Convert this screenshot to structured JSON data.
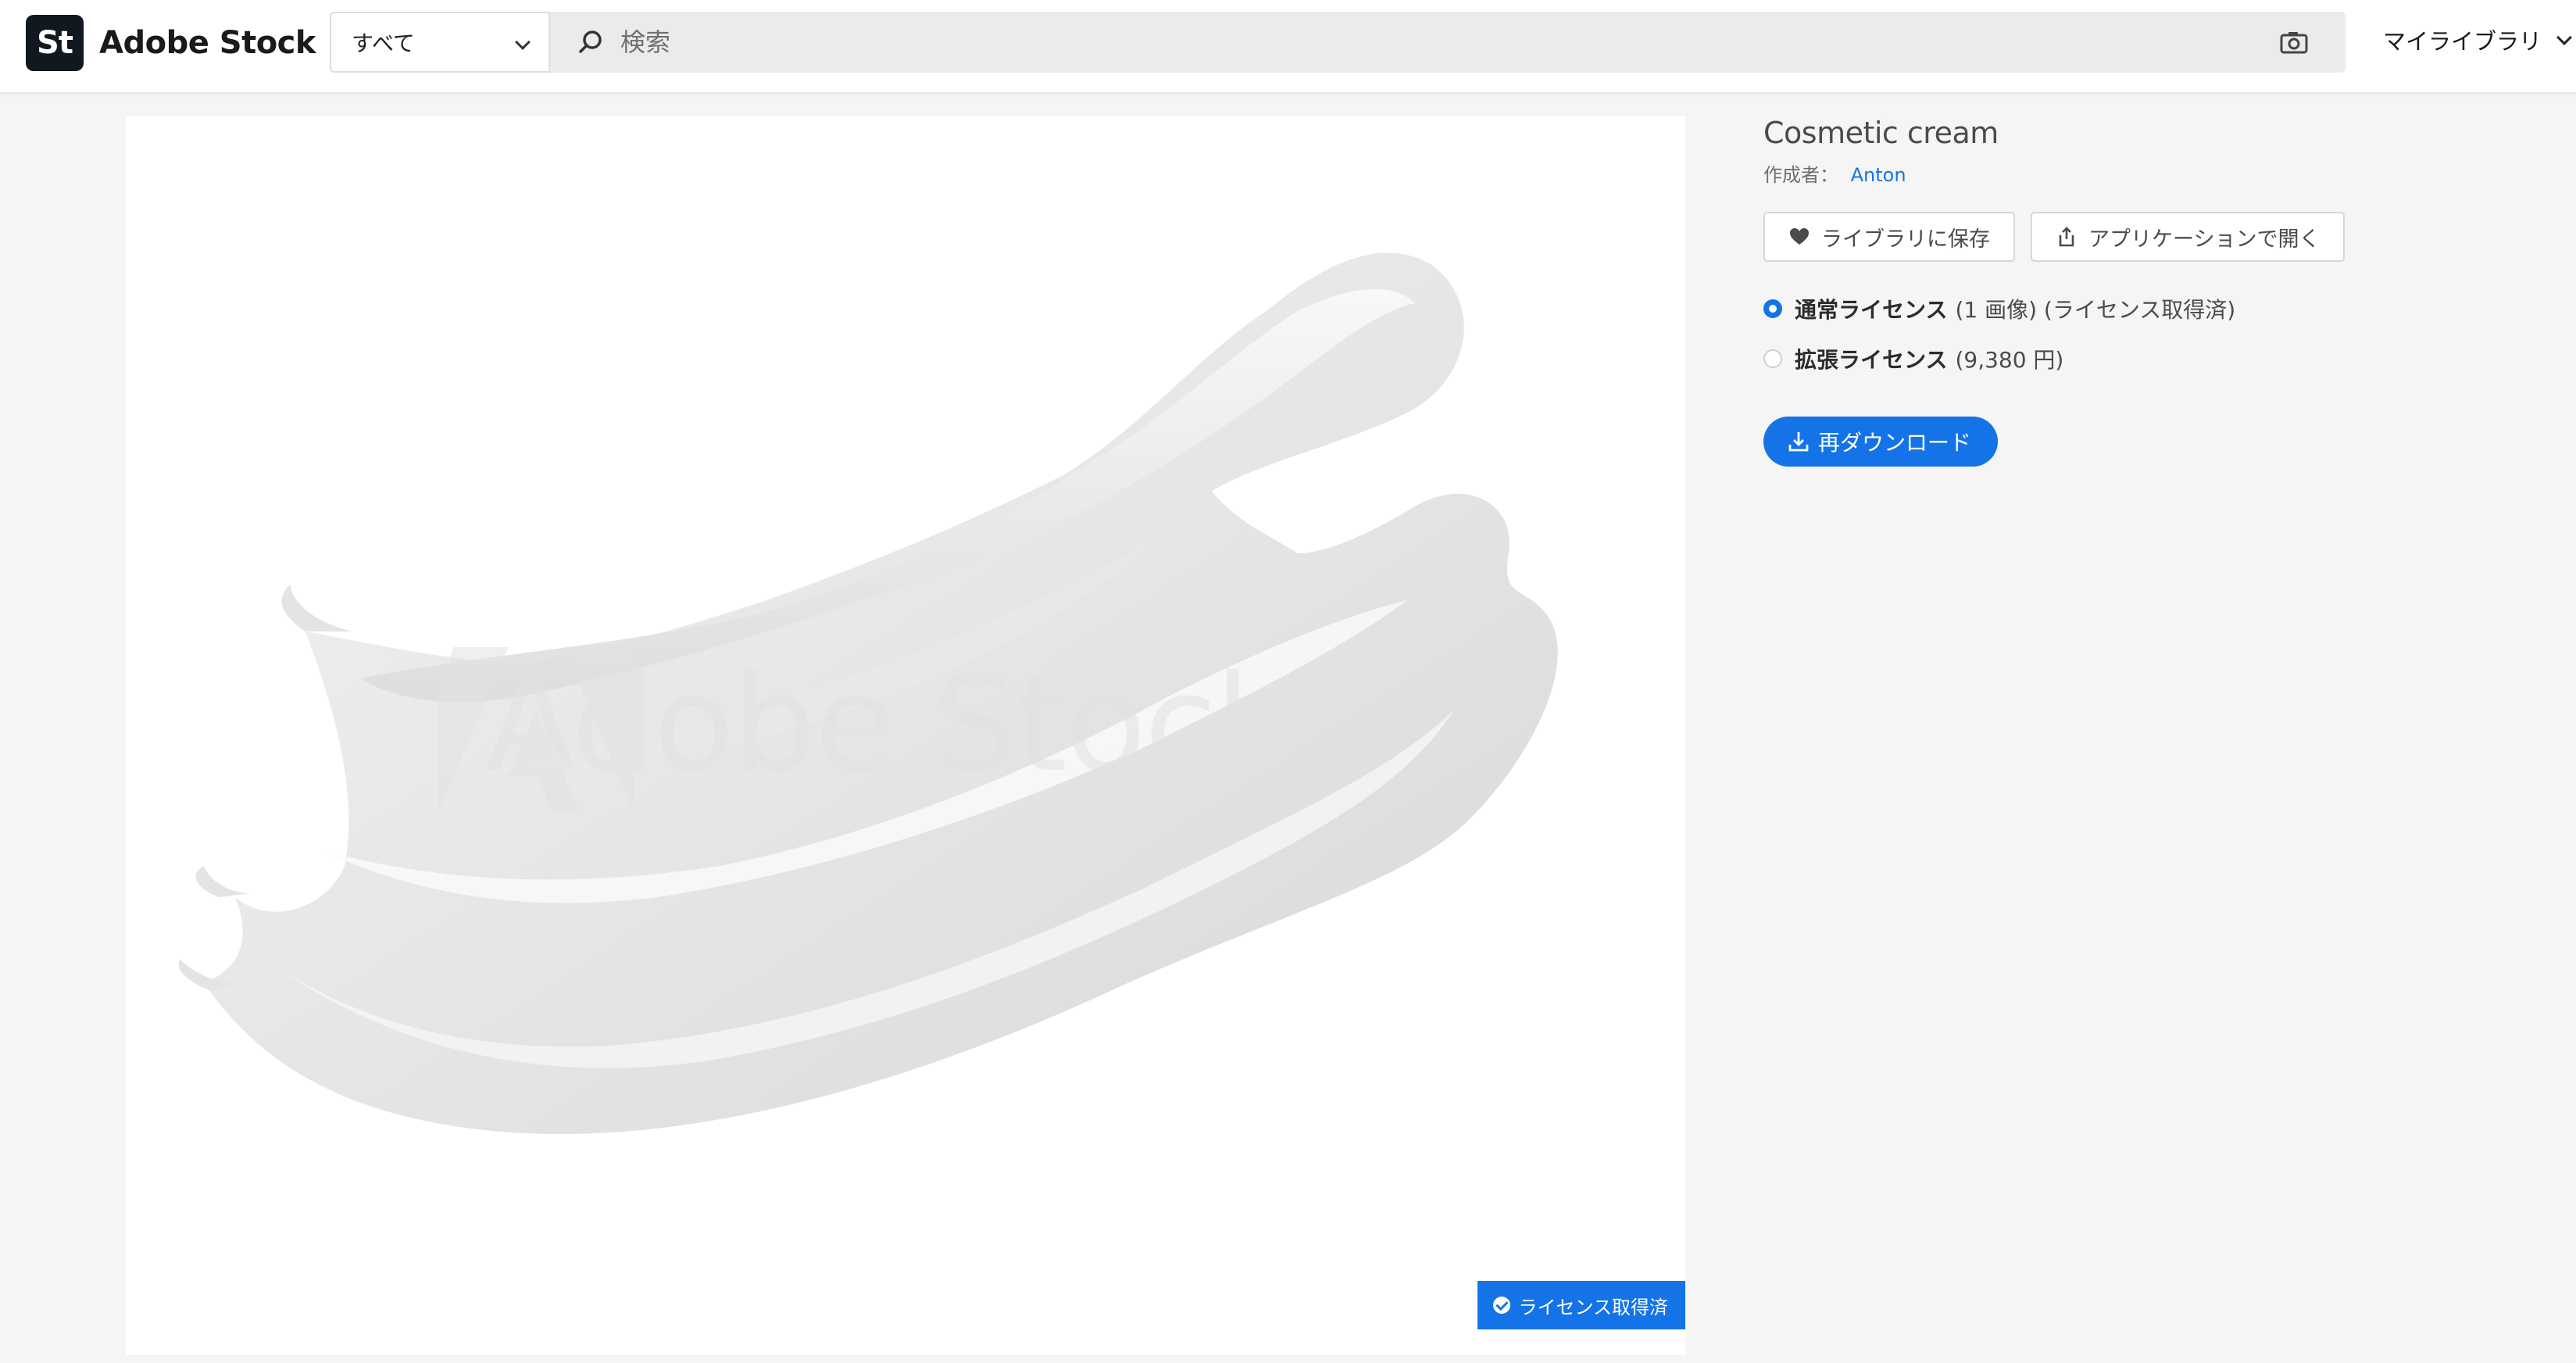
{
  "header": {
    "logo_badge": "St",
    "logo_text": "Adobe Stock",
    "scope_label": "すべて",
    "search_placeholder": "検索",
    "my_library_label": "マイライブラリ"
  },
  "asset": {
    "watermark_text": "Adobe Stock",
    "licensed_badge": "ライセンス取得済",
    "title": "Cosmetic cream",
    "author_prefix": "作成者：",
    "author_name": "Anton"
  },
  "actions": {
    "save_label": "ライブラリに保存",
    "open_in_app_label": "アプリケーションで開く"
  },
  "licenses": [
    {
      "name": "通常ライセンス",
      "detail": "(1 画像) (ライセンス取得済)",
      "selected": true
    },
    {
      "name": "拡張ライセンス",
      "detail": "(9,380 円)",
      "selected": false
    }
  ],
  "redownload_label": "再ダウンロード",
  "colors": {
    "accent": "#1473e6",
    "logo_bg": "#12181f"
  }
}
